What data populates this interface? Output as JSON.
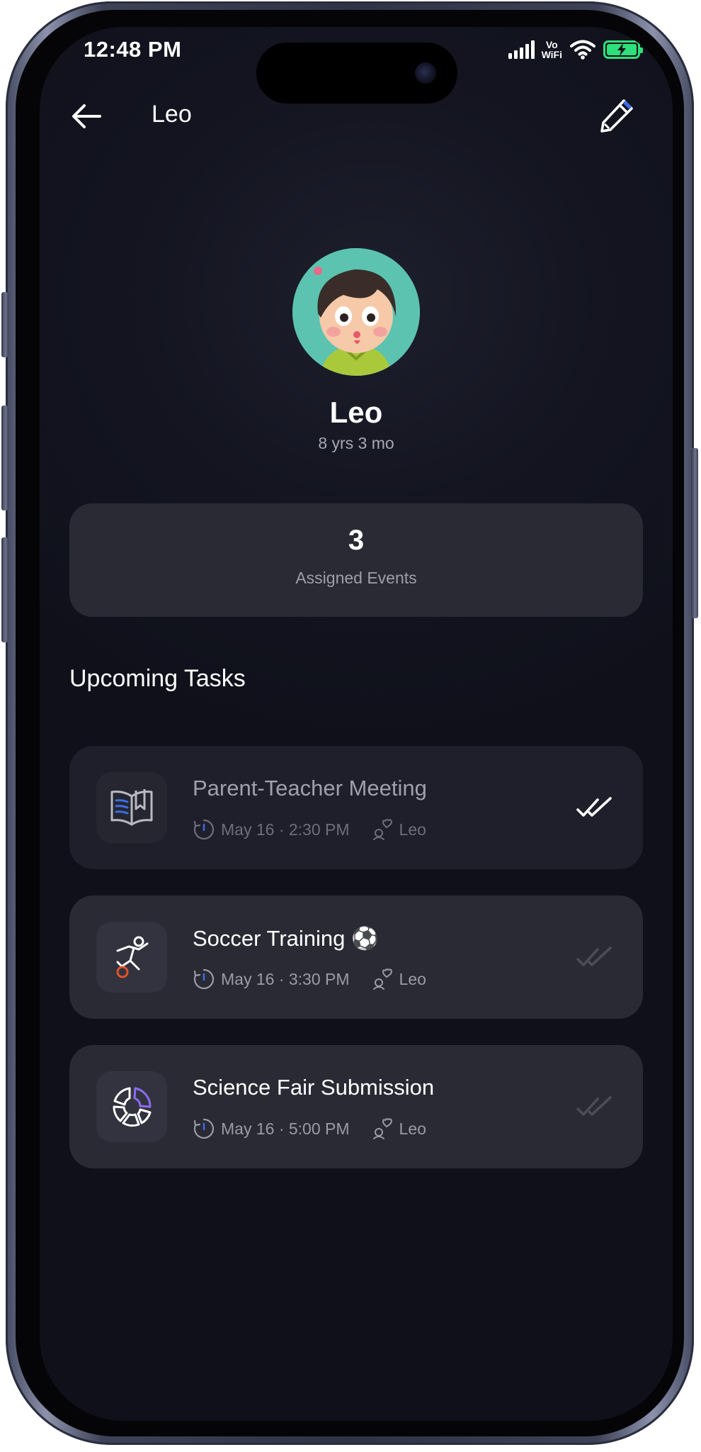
{
  "status_bar": {
    "time": "12:48 PM",
    "network_label_top": "Vo",
    "network_label_bottom": "WiFi",
    "battery_color": "#2fe07a"
  },
  "nav": {
    "back_icon": "arrow-left-icon",
    "title": "Leo",
    "edit_icon": "pencil-icon"
  },
  "profile": {
    "name": "Leo",
    "age": "8 yrs 3 mo"
  },
  "stats": {
    "value": "3",
    "label": "Assigned Events"
  },
  "section": {
    "title": "Upcoming Tasks"
  },
  "tasks": [
    {
      "title": "Parent-Teacher Meeting",
      "time": "May 16 · 2:30 PM",
      "assignee": "Leo",
      "icon": "open-book-icon",
      "completed": true
    },
    {
      "title": "Soccer Training ⚽",
      "time": "May 16 · 3:30 PM",
      "assignee": "Leo",
      "icon": "soccer-player-icon",
      "completed": false
    },
    {
      "title": "Science Fair Submission",
      "time": "May 16 · 5:00 PM",
      "assignee": "Leo",
      "icon": "pie-chart-icon",
      "completed": false
    }
  ],
  "colors": {
    "background": "#0f101a",
    "card": "#2a2a35",
    "card_completed": "#1e1f2a",
    "accent_purple": "#8b6cf0",
    "accent_orange": "#e2522b",
    "accent_blue": "#3b6ee8"
  }
}
